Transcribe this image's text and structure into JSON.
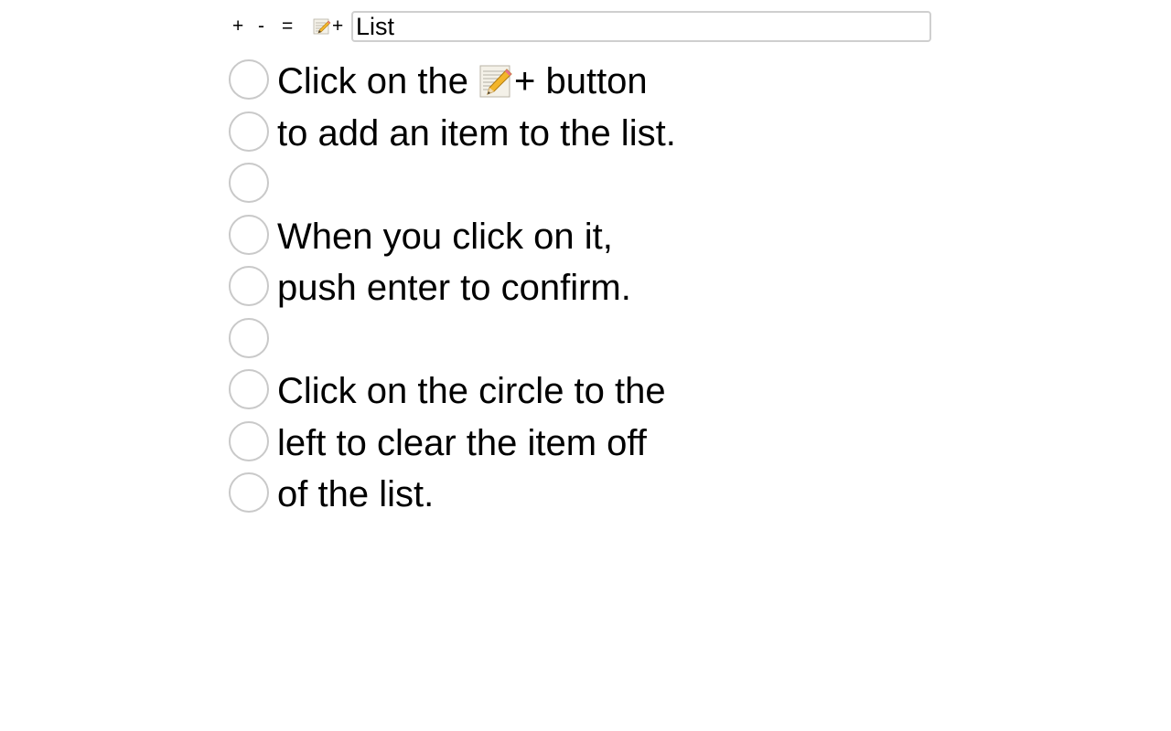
{
  "toolbar": {
    "plus_label": "+",
    "minus_label": "-",
    "equals_label": "=",
    "add_icon": "memo-pencil-icon",
    "add_plus": "+"
  },
  "title_input": {
    "value": "List"
  },
  "items": [
    {
      "before": "Click on the",
      "icon": "memo-pencil-icon",
      "after": "+ button"
    },
    {
      "text": "to add an item to the list."
    },
    {
      "text": ""
    },
    {
      "text": "When you click on it,"
    },
    {
      "text": "push enter to confirm."
    },
    {
      "text": ""
    },
    {
      "text": "Click on the circle to the"
    },
    {
      "text": "left to clear the item off"
    },
    {
      "text": "of the list."
    }
  ],
  "colors": {
    "circle_border": "#c9c9c9",
    "input_border": "#cfcfcf",
    "text": "#000000",
    "background": "#ffffff"
  }
}
